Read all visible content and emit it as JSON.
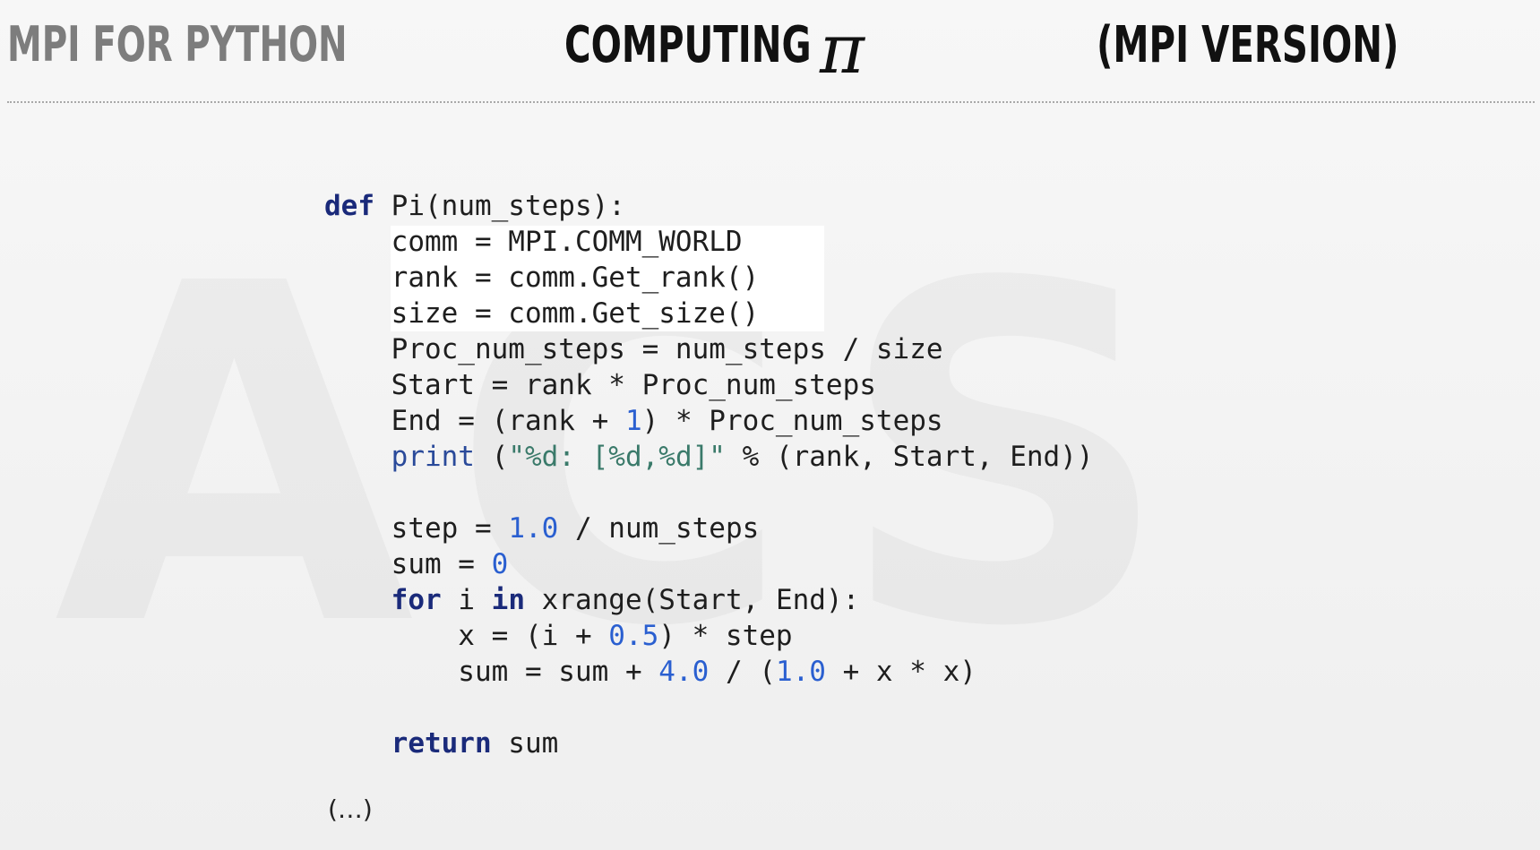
{
  "header": {
    "left": "MPI FOR PYTHON",
    "center": "COMPUTING",
    "symbol": "π",
    "right": "(MPI VERSION)"
  },
  "code": {
    "lines": [
      [
        {
          "t": "def",
          "c": "kw"
        },
        {
          "t": " Pi(num_steps):",
          "c": ""
        }
      ],
      [
        {
          "t": "    comm = MPI.COMM_WORLD",
          "c": ""
        }
      ],
      [
        {
          "t": "    rank = comm.Get_rank()",
          "c": ""
        }
      ],
      [
        {
          "t": "    size = comm.Get_size()",
          "c": ""
        }
      ],
      [
        {
          "t": "    Proc_num_steps = num_steps / size",
          "c": ""
        }
      ],
      [
        {
          "t": "    Start = rank * Proc_num_steps",
          "c": ""
        }
      ],
      [
        {
          "t": "    End = (rank + ",
          "c": ""
        },
        {
          "t": "1",
          "c": "num"
        },
        {
          "t": ") * Proc_num_steps",
          "c": ""
        }
      ],
      [
        {
          "t": "    ",
          "c": ""
        },
        {
          "t": "print",
          "c": "fn"
        },
        {
          "t": " (",
          "c": ""
        },
        {
          "t": "\"%d: [%d,%d]\"",
          "c": "str"
        },
        {
          "t": " % (rank, Start, End))",
          "c": ""
        }
      ],
      [
        {
          "t": "",
          "c": ""
        }
      ],
      [
        {
          "t": "    step = ",
          "c": ""
        },
        {
          "t": "1.0",
          "c": "num"
        },
        {
          "t": " / num_steps",
          "c": ""
        }
      ],
      [
        {
          "t": "    sum = ",
          "c": ""
        },
        {
          "t": "0",
          "c": "num"
        }
      ],
      [
        {
          "t": "    ",
          "c": ""
        },
        {
          "t": "for",
          "c": "kw"
        },
        {
          "t": " i ",
          "c": ""
        },
        {
          "t": "in",
          "c": "kw"
        },
        {
          "t": " xrange(Start, End):",
          "c": ""
        }
      ],
      [
        {
          "t": "        x = (i + ",
          "c": ""
        },
        {
          "t": "0.5",
          "c": "num"
        },
        {
          "t": ") * step",
          "c": ""
        }
      ],
      [
        {
          "t": "        sum = sum + ",
          "c": ""
        },
        {
          "t": "4.0",
          "c": "num"
        },
        {
          "t": " / (",
          "c": ""
        },
        {
          "t": "1.0",
          "c": "num"
        },
        {
          "t": " + x * x)",
          "c": ""
        }
      ],
      [
        {
          "t": "",
          "c": ""
        }
      ],
      [
        {
          "t": "    ",
          "c": ""
        },
        {
          "t": "return",
          "c": "kw"
        },
        {
          "t": " sum",
          "c": ""
        }
      ]
    ]
  },
  "ellipsis": "(…)"
}
